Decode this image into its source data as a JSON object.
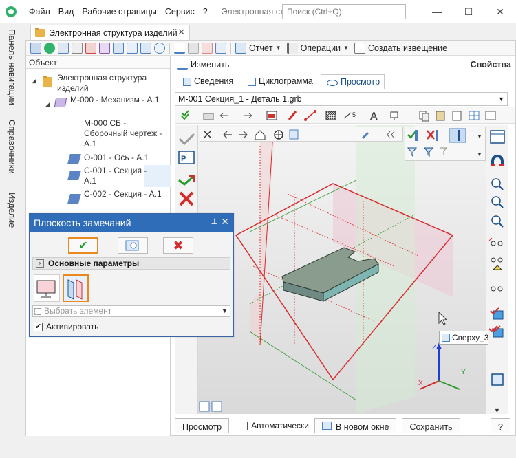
{
  "menu": [
    "Файл",
    "Вид",
    "Рабочие страницы",
    "Сервис",
    "?"
  ],
  "window_title": "Электронная стр...",
  "search": {
    "placeholder": "Поиск (Ctrl+Q)"
  },
  "window_controls": {
    "minimize": "—",
    "maximize": "☐",
    "close": "✕"
  },
  "vertical_tabs": [
    "Панель навигации",
    "Справочники",
    "Изделие"
  ],
  "doc_tab": {
    "label": "Электронная структура изделий",
    "close": "✕"
  },
  "toolbar": {
    "report": "Отчёт",
    "operations": "Операции",
    "create_notice": "Создать извещение"
  },
  "tree": {
    "header": "Объект",
    "nodes": [
      {
        "label": "Электронная структура изделий"
      },
      {
        "label": "М-000 - Механизм - А.1"
      },
      {
        "label": "М-000 СБ - Сборочный чертеж - А.1"
      },
      {
        "label": "О-001 - Ось - А.1"
      },
      {
        "label": "С-001 - Секция - А.1"
      },
      {
        "label": "С-002 - Секция - А.1"
      }
    ]
  },
  "props": {
    "edit": "Изменить",
    "title": "Свойства"
  },
  "tabs": [
    "Сведения",
    "Циклограмма",
    "Просмотр"
  ],
  "active_tab": "Просмотр",
  "file_select": "М-001 Секция_1 - Деталь 1.grb",
  "tooltip": "Сверху_3",
  "axes": {
    "x": "X",
    "y": "Y",
    "z": "Z"
  },
  "bottom": {
    "preview": "Просмотр",
    "auto": "Автоматически",
    "new_window": "В новом окне",
    "save": "Сохранить",
    "help": "?"
  },
  "dialog": {
    "title": "Плоскость замечаний",
    "pin": "📌",
    "close": "✕",
    "section": "Основные параметры",
    "collapse": "«",
    "select_placeholder": "Выбрать элемент",
    "activate_label": "Активировать",
    "activate_checked": "✔",
    "ok": "✔",
    "cancel": "✖"
  },
  "colors": {
    "accent": "#2f6db8",
    "highlight": "#e88a1f",
    "ok": "#2b9a2b",
    "cancel": "#d62b2b"
  }
}
